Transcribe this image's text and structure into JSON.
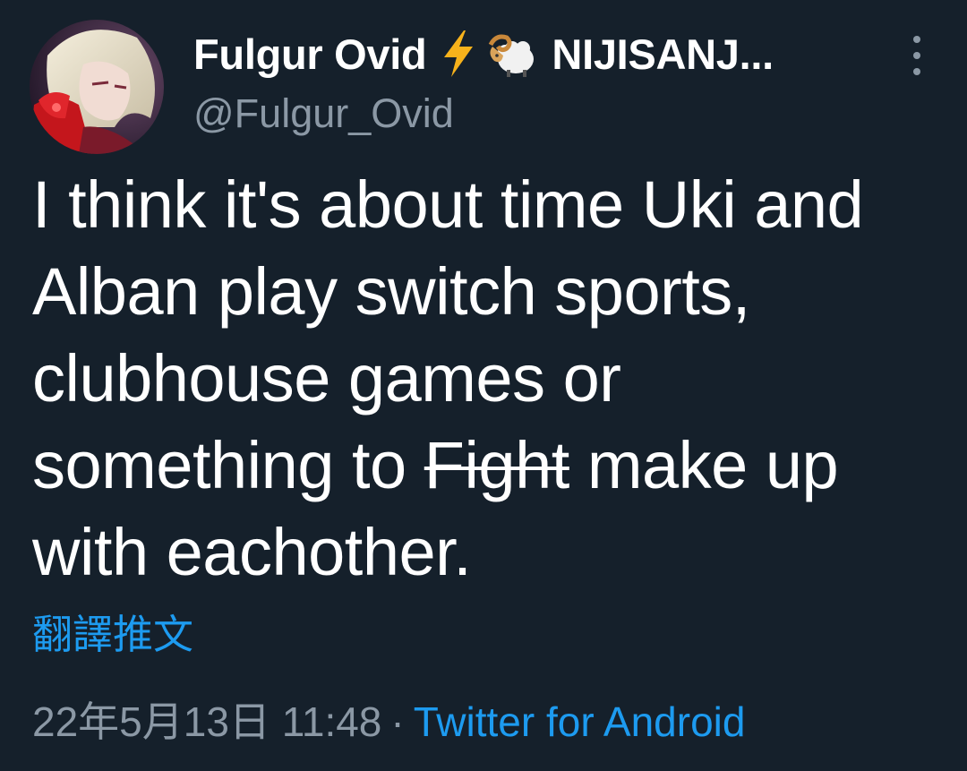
{
  "tweet": {
    "author": {
      "display_name": "Fulgur Ovid",
      "display_name_suffix": "NIJISANJ...",
      "handle": "@Fulgur_Ovid",
      "avatar_icon": "profile-avatar",
      "badges": [
        "lightning-emoji-icon",
        "ram-emoji-icon"
      ]
    },
    "more_icon": "more-options-icon",
    "text": {
      "line1": "I think it's about time Uki and",
      "line2": "Alban play switch sports,",
      "line3": "clubhouse games or",
      "line4_before": "something to ",
      "line4_strikethrough": "Fight",
      "line4_after": " make up",
      "line5": "with eachother."
    },
    "translate_label": "翻譯推文",
    "timestamp": "22年5月13日 11:48",
    "separator": "·",
    "source": "Twitter for Android",
    "colors": {
      "background": "#15202b",
      "link": "#1d9bf0",
      "secondary_text": "#8b98a5",
      "primary_text": "#ffffff"
    }
  }
}
